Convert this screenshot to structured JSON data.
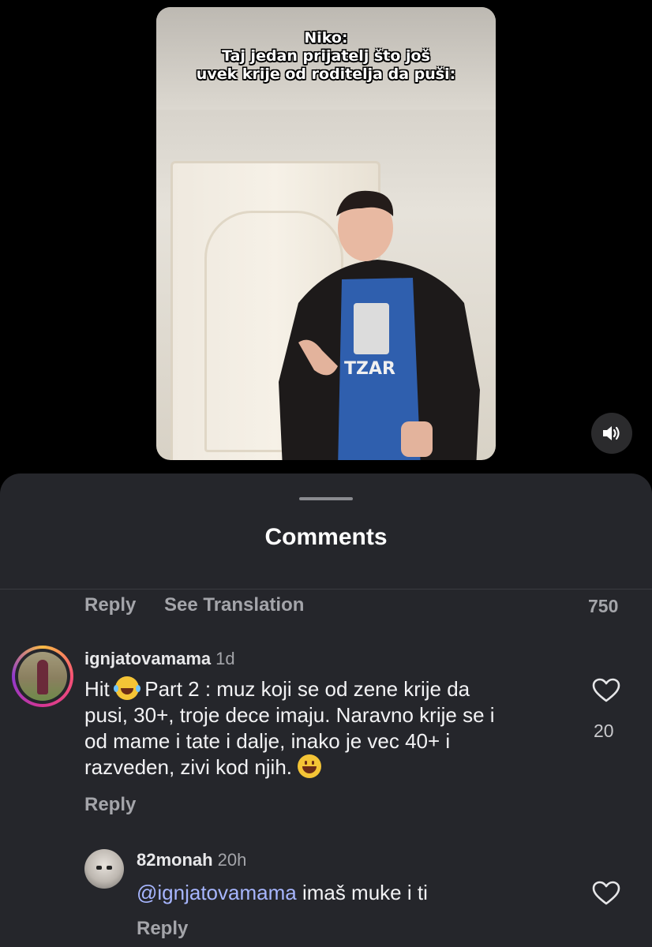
{
  "video": {
    "caption_lines": [
      "Niko:",
      "Taj jedan prijatelj što još",
      "uvek krije od roditelja da puši:"
    ],
    "shirt_text": "TZAR"
  },
  "sound_button": {
    "icon": "speaker-icon"
  },
  "sheet": {
    "title": "Comments",
    "top_actions": {
      "reply": "Reply",
      "see_translation": "See Translation",
      "count": "750"
    }
  },
  "comments": [
    {
      "username": "ignjatovamama",
      "time": "1d",
      "lines": [
        "Part 2 : muz koji se od zene krije da",
        "pusi, 30+, troje dece imaju. Naravno krije se i",
        "od mame i tate i dalje, inako je vec 40+ i",
        "razveden, zivi kod njih."
      ],
      "prefix": "Hit",
      "likes": "20",
      "reply_label": "Reply"
    },
    {
      "username": "82monah",
      "time": "20h",
      "mention": "@ignjatovamama",
      "text": " imaš muke i ti",
      "reply_label": "Reply"
    }
  ]
}
